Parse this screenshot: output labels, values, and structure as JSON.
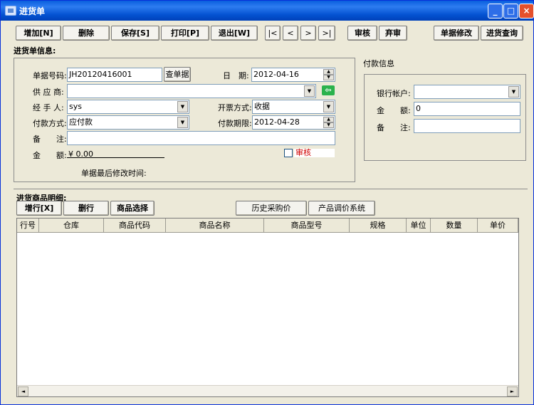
{
  "window": {
    "title": "进货单",
    "minimize": "_",
    "maximize": "□",
    "close": "×"
  },
  "toolbar": {
    "add": "增加[N]",
    "delete": "删除",
    "save": "保存[S]",
    "print": "打印[P]",
    "exit": "退出[W]",
    "first": "|<",
    "prev": "<",
    "next": ">",
    "last": ">|",
    "audit": "审核",
    "abandon": "弃审",
    "modify": "单据修改",
    "query": "进货查询"
  },
  "info": {
    "title": "进货单信息:",
    "doc_no_label": "单据号码:",
    "doc_no": "JH20120416001",
    "lookup_button": "查单据",
    "date_label": "日　期:",
    "date": "2012-04-16",
    "supplier_label": "供 应 商:",
    "supplier": "",
    "handler_label": "经 手 人:",
    "handler": "sys",
    "invoice_label": "开票方式:",
    "invoice": "收据",
    "pay_method_label": "付款方式:",
    "pay_method": "应付款",
    "due_label": "付款期限:",
    "due": "2012-04-28",
    "remark_label": "备　　注:",
    "remark": "",
    "amount_label": "金　　额:",
    "amount": "¥ 0.00",
    "audit_label": "审核",
    "last_modified_label": "单据最后修改时间:"
  },
  "payment": {
    "title": "付款信息",
    "bank_label": "银行帐户:",
    "bank": "",
    "amount_label": "金　　额:",
    "amount": "0",
    "remark_label": "备　　注:",
    "remark": ""
  },
  "detail": {
    "title": "进货商品明细:",
    "add_row": "增行[X]",
    "del_row": "删行",
    "select": "商品选择",
    "history": "历史采购价",
    "pricing": "产品调价系统",
    "columns": [
      "行号",
      "仓库",
      "商品代码",
      "商品名称",
      "商品型号",
      "规格",
      "单位",
      "数量",
      "单价"
    ]
  },
  "scroll": {
    "left": "◄",
    "right": "►"
  }
}
